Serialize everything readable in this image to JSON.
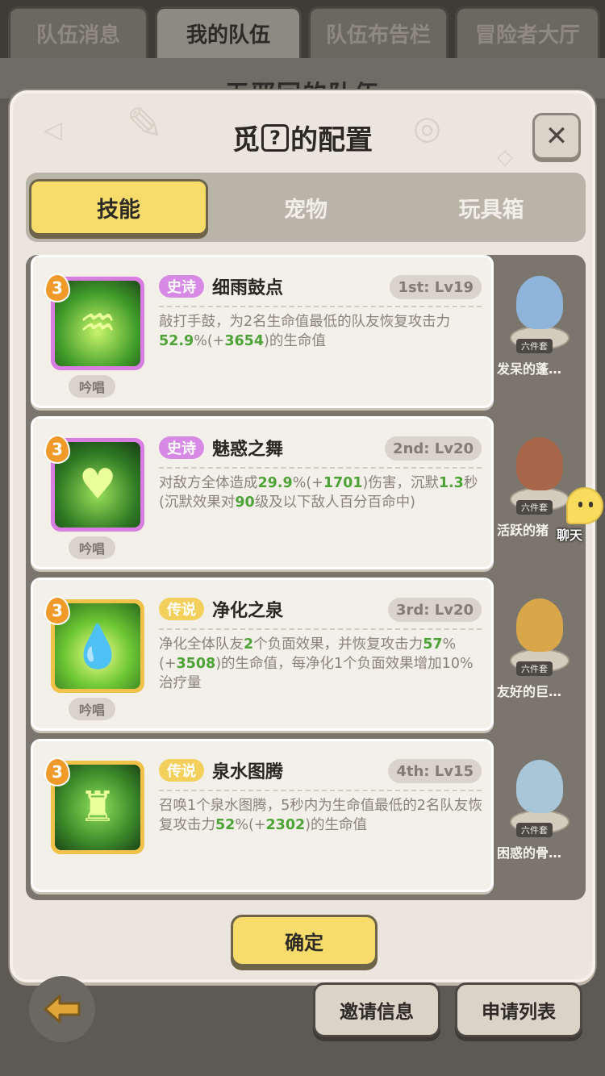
{
  "top_tabs": [
    {
      "label": "队伍消息",
      "active": false
    },
    {
      "label": "我的队伍",
      "active": true
    },
    {
      "label": "队伍布告栏",
      "active": false
    },
    {
      "label": "冒险者大厅",
      "active": false
    }
  ],
  "background_title": "无邪回的队伍",
  "modal": {
    "title_prefix": "觅",
    "title_mark": "?",
    "title_suffix": "的配置",
    "close_icon": "close-icon",
    "tabs": [
      {
        "label": "技能",
        "active": true
      },
      {
        "label": "宠物",
        "active": false
      },
      {
        "label": "玩具箱",
        "active": false
      }
    ],
    "skills": [
      {
        "level": "3",
        "rarity": "史诗",
        "rarity_class": "epic",
        "name": "细雨鼓点",
        "rank": "1st: Lv19",
        "cast_tag": "吟唱",
        "icon": "drum-rain-icon",
        "desc": [
          {
            "t": "敲打手鼓，为2名生命值最低的队友恢复攻击力"
          },
          {
            "t": "52.9",
            "hl": true
          },
          {
            "t": "%(+"
          },
          {
            "t": "3654",
            "hl": true
          },
          {
            "t": ")的生命值"
          }
        ]
      },
      {
        "level": "3",
        "rarity": "史诗",
        "rarity_class": "epic",
        "name": "魅惑之舞",
        "rank": "2nd: Lv20",
        "cast_tag": "吟唱",
        "icon": "dance-icon",
        "desc": [
          {
            "t": "对敌方全体造成"
          },
          {
            "t": "29.9",
            "hl": true
          },
          {
            "t": "%(+"
          },
          {
            "t": "1701",
            "hl": true
          },
          {
            "t": ")伤害，沉默"
          },
          {
            "t": "1.3",
            "hl": true
          },
          {
            "t": "秒(沉默效果对"
          },
          {
            "t": "90",
            "hl": true
          },
          {
            "t": "级及以下敌人百分百命中)"
          }
        ]
      },
      {
        "level": "3",
        "rarity": "传说",
        "rarity_class": "legend",
        "name": "净化之泉",
        "rank": "3rd: Lv20",
        "cast_tag": "吟唱",
        "icon": "water-drop-icon",
        "desc": [
          {
            "t": "净化全体队友"
          },
          {
            "t": "2",
            "hl": true
          },
          {
            "t": "个负面效果，并恢复攻击力"
          },
          {
            "t": "57",
            "hl": true
          },
          {
            "t": "%(+"
          },
          {
            "t": "3508",
            "hl": true
          },
          {
            "t": ")的生命值，每净化1个负面效果增加10%治疗量"
          }
        ]
      },
      {
        "level": "3",
        "rarity": "传说",
        "rarity_class": "legend",
        "name": "泉水图腾",
        "rank": "4th: Lv15",
        "cast_tag": "",
        "icon": "totem-icon",
        "desc": [
          {
            "t": "召唤1个泉水图腾，5秒内为生命值最低的2名队友恢复攻击力"
          },
          {
            "t": "52",
            "hl": true
          },
          {
            "t": "%(+"
          },
          {
            "t": "2302",
            "hl": true
          },
          {
            "t": ")的生命值"
          }
        ]
      }
    ],
    "pets": [
      {
        "name": "发呆的蓬…",
        "set": "六件套",
        "color": "#8fb4d9"
      },
      {
        "name": "活跃的猪",
        "set": "六件套",
        "color": "#a8664a"
      },
      {
        "name": "友好的巨…",
        "set": "六件套",
        "color": "#d9a64a"
      },
      {
        "name": "困惑的骨…",
        "set": "六件套",
        "color": "#a9c6d8"
      }
    ],
    "confirm_label": "确定"
  },
  "chat_label": "聊天",
  "bottom": {
    "back_icon": "back-arrow-icon",
    "invite_label": "邀请信息",
    "apply_label": "申请列表"
  }
}
